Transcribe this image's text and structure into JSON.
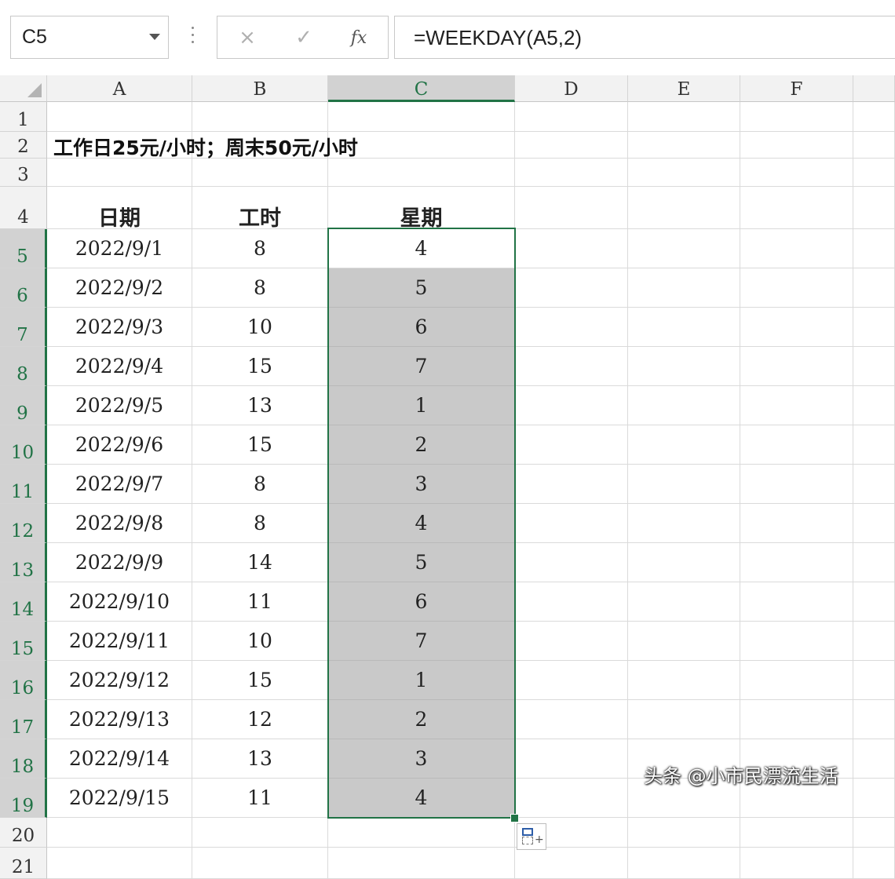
{
  "formula_bar": {
    "name_box": "C5",
    "cancel_icon": "×",
    "confirm_icon": "✓",
    "fx_label": "fx",
    "formula": "=WEEKDAY(A5,2)"
  },
  "columns": [
    "A",
    "B",
    "C",
    "D",
    "E",
    "F"
  ],
  "selected_column": "C",
  "rows": [
    "1",
    "2",
    "3",
    "4",
    "5",
    "6",
    "7",
    "8",
    "9",
    "10",
    "11",
    "12",
    "13",
    "14",
    "15",
    "16",
    "17",
    "18",
    "19",
    "20",
    "21"
  ],
  "sheet": {
    "title": "工作日25元/小时；周末50元/小时",
    "headers": {
      "date": "日期",
      "hours": "工时",
      "weekday": "星期"
    },
    "data": [
      {
        "date": "2022/9/1",
        "hours": "8",
        "weekday": "4"
      },
      {
        "date": "2022/9/2",
        "hours": "8",
        "weekday": "5"
      },
      {
        "date": "2022/9/3",
        "hours": "10",
        "weekday": "6"
      },
      {
        "date": "2022/9/4",
        "hours": "15",
        "weekday": "7"
      },
      {
        "date": "2022/9/5",
        "hours": "13",
        "weekday": "1"
      },
      {
        "date": "2022/9/6",
        "hours": "15",
        "weekday": "2"
      },
      {
        "date": "2022/9/7",
        "hours": "8",
        "weekday": "3"
      },
      {
        "date": "2022/9/8",
        "hours": "8",
        "weekday": "4"
      },
      {
        "date": "2022/9/9",
        "hours": "14",
        "weekday": "5"
      },
      {
        "date": "2022/9/10",
        "hours": "11",
        "weekday": "6"
      },
      {
        "date": "2022/9/11",
        "hours": "10",
        "weekday": "7"
      },
      {
        "date": "2022/9/12",
        "hours": "15",
        "weekday": "1"
      },
      {
        "date": "2022/9/13",
        "hours": "12",
        "weekday": "2"
      },
      {
        "date": "2022/9/14",
        "hours": "13",
        "weekday": "3"
      },
      {
        "date": "2022/9/15",
        "hours": "11",
        "weekday": "4"
      }
    ]
  },
  "watermark": "头条 @小市民漂流生活",
  "colors": {
    "accent": "#217346",
    "selection_fill": "#c9c9c9",
    "header_bg": "#f2f2f2"
  }
}
